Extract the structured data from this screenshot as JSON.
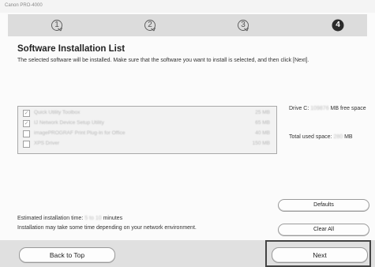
{
  "window": {
    "title": "Canon PRO-4000"
  },
  "steps": [
    {
      "number": "1",
      "state": "done"
    },
    {
      "number": "2",
      "state": "done"
    },
    {
      "number": "3",
      "state": "done"
    },
    {
      "number": "4",
      "state": "current"
    }
  ],
  "page": {
    "heading": "Software Installation List",
    "description": "The selected software will be installed. Make sure that the software you want to install is selected, and then click [Next]."
  },
  "software_list": [
    {
      "name": "Quick Utility Toolbox",
      "size": "25 MB",
      "checked": true
    },
    {
      "name": "IJ Network Device Setup Utility",
      "size": "65 MB",
      "checked": true
    },
    {
      "name": "imagePROGRAF Print Plug-In for Office",
      "size": "40 MB",
      "checked": false
    },
    {
      "name": "XPS Driver",
      "size": "150 MB",
      "checked": false
    }
  ],
  "drive_info": {
    "prefix": "Drive C: ",
    "value": "109876",
    "suffix": " MB free space"
  },
  "total_used": {
    "prefix": "Total used space: ",
    "value": "280",
    "suffix": " MB"
  },
  "estimate": {
    "prefix": "Estimated installation time: ",
    "value": "5 to 10",
    "suffix": " minutes"
  },
  "note": "Installation may take some time depending on your network environment.",
  "buttons": {
    "defaults": "Defaults",
    "clear_all": "Clear All",
    "back_to_top": "Back to Top",
    "next": "Next"
  },
  "colors": {
    "step_bar": "#dcdcdc",
    "step_current": "#2b2b2b",
    "highlight_frame": "#444444"
  }
}
